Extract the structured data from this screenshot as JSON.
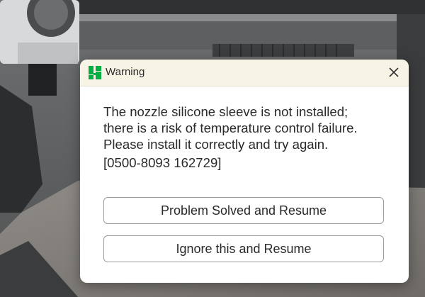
{
  "dialog": {
    "title": "Warning",
    "app_icon": "bambu-logo-icon",
    "close_icon": "close-icon",
    "message_lines": [
      "The nozzle silicone sleeve is not installed;",
      "there is a risk of temperature control failure.",
      "Please install it correctly and try again."
    ],
    "error_code": "[0500-8093 162729]",
    "buttons": {
      "resume_label": "Problem Solved and Resume",
      "ignore_label": "Ignore this and Resume"
    }
  },
  "colors": {
    "titlebar_bg": "#f7f4e6",
    "accent_green": "#00ae42",
    "button_border": "#9b9b9b",
    "text": "#2a2a2a"
  }
}
